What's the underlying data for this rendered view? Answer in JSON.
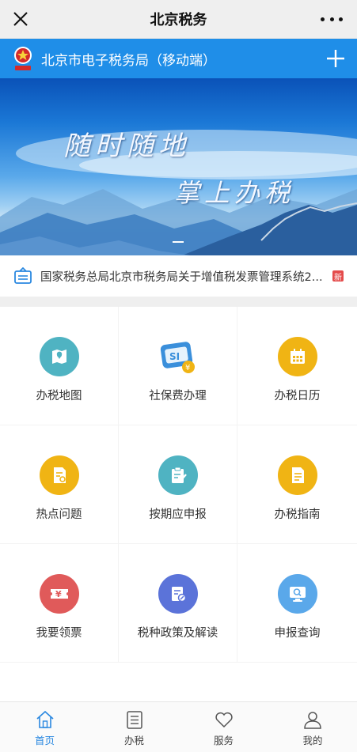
{
  "nav": {
    "title": "北京税务"
  },
  "header": {
    "title": "北京市电子税务局（移动端）"
  },
  "banner": {
    "line1": "随时随地",
    "line2": "掌上办税"
  },
  "notice": {
    "text": "国家税务总局北京市税务局关于增值税发票管理系统2...",
    "badge": "新"
  },
  "grid": {
    "items": [
      {
        "label": "办税地图",
        "icon": "map-icon",
        "color": "#4fb3c2"
      },
      {
        "label": "社保费办理",
        "icon": "social-security-card-icon",
        "color": "#3a8fdb"
      },
      {
        "label": "办税日历",
        "icon": "calendar-icon",
        "color": "#f0b414"
      },
      {
        "label": "热点问题",
        "icon": "hot-question-doc-icon",
        "color": "#f0b414"
      },
      {
        "label": "按期应申报",
        "icon": "declare-form-icon",
        "color": "#4fb3c2"
      },
      {
        "label": "办税指南",
        "icon": "guide-doc-icon",
        "color": "#f0b414"
      },
      {
        "label": "我要领票",
        "icon": "ticket-yuan-icon",
        "color": "#e05a5a"
      },
      {
        "label": "税种政策及解读",
        "icon": "policy-doc-icon",
        "color": "#5b73d9"
      },
      {
        "label": "申报查询",
        "icon": "search-monitor-icon",
        "color": "#5aa8ea"
      }
    ]
  },
  "tabbar": {
    "tabs": [
      {
        "label": "首页",
        "icon": "home-icon",
        "active": true
      },
      {
        "label": "办税",
        "icon": "list-icon",
        "active": false
      },
      {
        "label": "服务",
        "icon": "heart-icon",
        "active": false
      },
      {
        "label": "我的",
        "icon": "user-icon",
        "active": false
      }
    ]
  },
  "colors": {
    "brand_blue": "#1f8ee8",
    "active_tab": "#2a88e0",
    "badge_red": "#e44b4b"
  }
}
